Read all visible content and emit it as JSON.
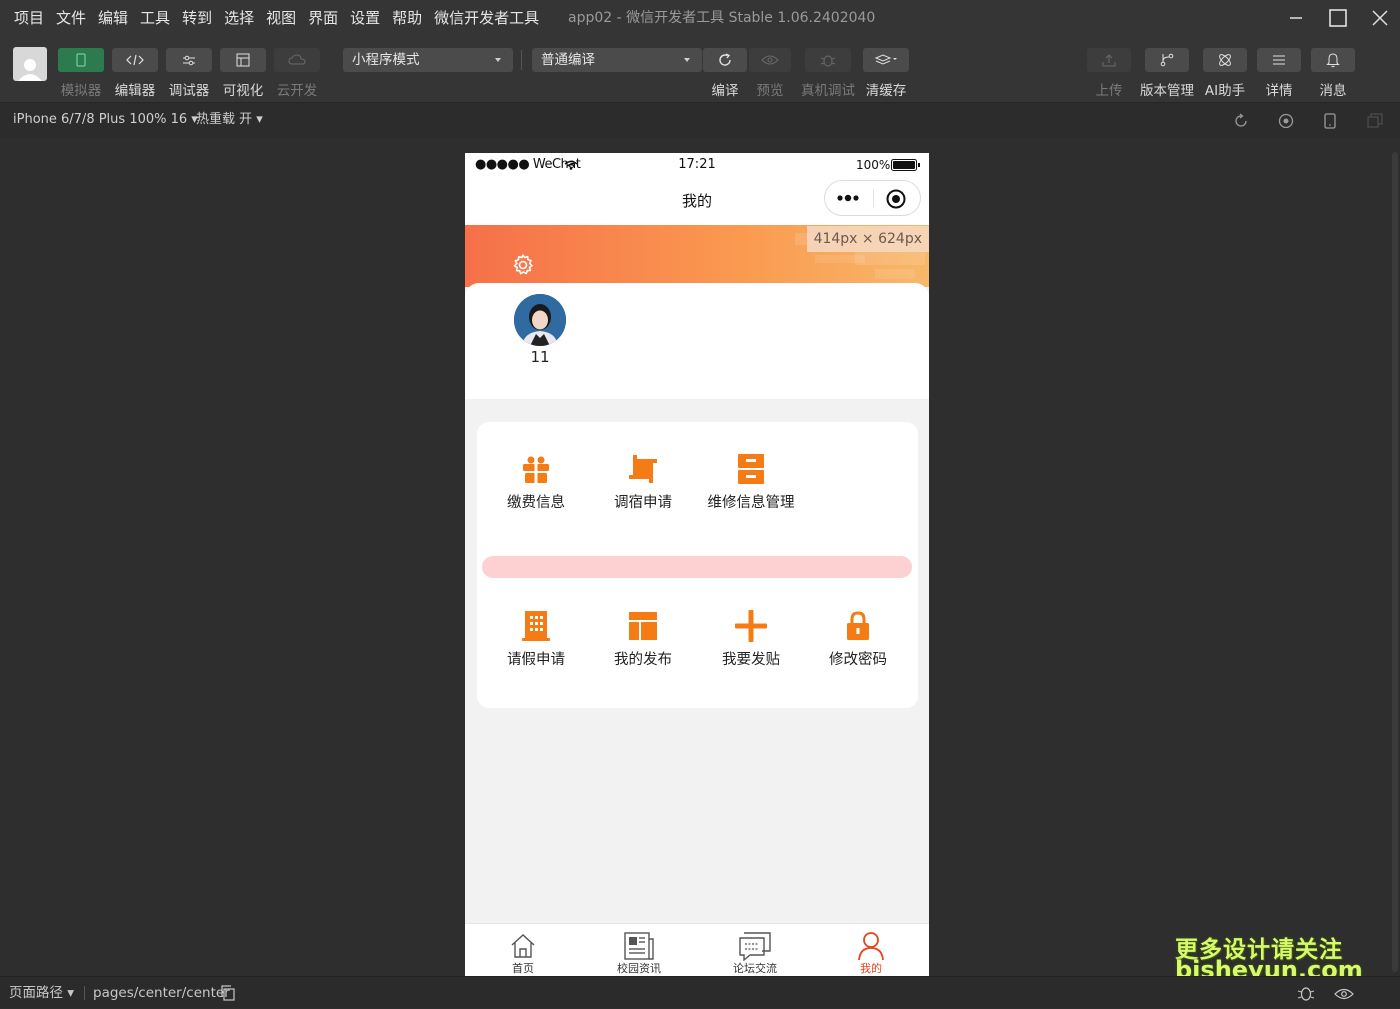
{
  "menu": {
    "items": [
      "项目",
      "文件",
      "编辑",
      "工具",
      "转到",
      "选择",
      "视图",
      "界面",
      "设置",
      "帮助",
      "微信开发者工具"
    ],
    "title": "app02 - 微信开发者工具 Stable 1.06.2402040"
  },
  "toolbar": {
    "simulator": "模拟器",
    "editor": "编辑器",
    "debugger": "调试器",
    "visual": "可视化",
    "cloud": "云开发",
    "mode_select": "小程序模式",
    "compile_select": "普通编译",
    "compile": "编译",
    "preview": "预览",
    "remote_debug": "真机调试",
    "clear_cache": "清缓存",
    "upload": "上传",
    "version": "版本管理",
    "ai": "AI助手",
    "details": "详情",
    "messages": "消息"
  },
  "devbar": {
    "device": "iPhone 6/7/8 Plus 100% 16",
    "hot_reload": "热重载 开"
  },
  "phone": {
    "carrier": "●●●●● WeChat",
    "time": "17:21",
    "battery": "100%",
    "nav_title": "我的",
    "size_tag": "414px × 624px",
    "username": "11",
    "grid_row1": [
      {
        "label": "缴费信息",
        "icon": "gift-icon"
      },
      {
        "label": "调宿申请",
        "icon": "crop-icon"
      },
      {
        "label": "维修信息管理",
        "icon": "archive-icon"
      }
    ],
    "grid_row2": [
      {
        "label": "请假申请",
        "icon": "building-icon"
      },
      {
        "label": "我的发布",
        "icon": "layout-icon"
      },
      {
        "label": "我要发贴",
        "icon": "plus-icon"
      },
      {
        "label": "修改密码",
        "icon": "lock-icon"
      }
    ],
    "tabs": [
      {
        "label": "首页",
        "icon": "home-icon"
      },
      {
        "label": "校园资讯",
        "icon": "news-icon"
      },
      {
        "label": "论坛交流",
        "icon": "chat-icon"
      },
      {
        "label": "我的",
        "icon": "user-icon"
      }
    ],
    "accent": "#f57c14"
  },
  "watermark": {
    "line1": "更多设计请关注",
    "line2": "bisheyun.com"
  },
  "footer": {
    "path_label": "页面路径",
    "path": "pages/center/center"
  }
}
